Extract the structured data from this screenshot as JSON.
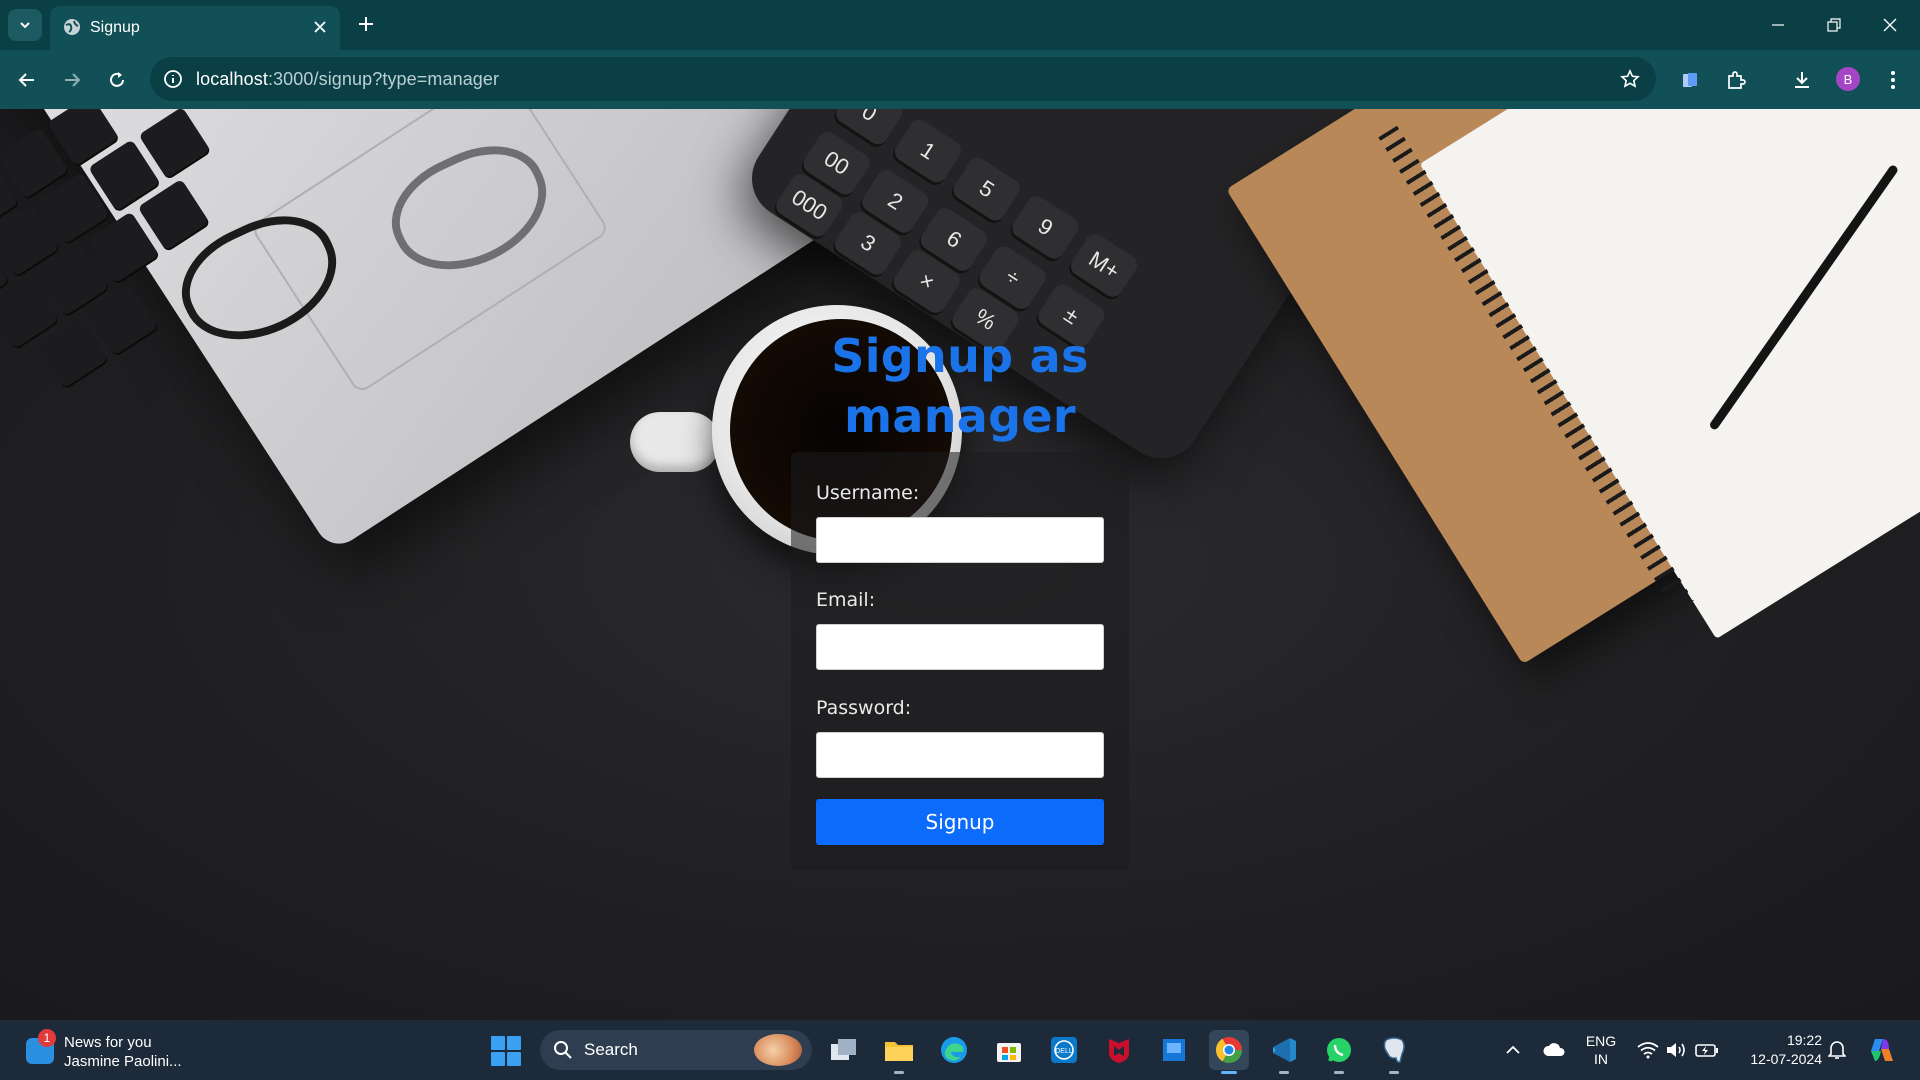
{
  "browser": {
    "tab_title": "Signup",
    "url_host": "localhost",
    "url_rest": ":3000/signup?type=manager",
    "profile_initial": "B",
    "colors": {
      "tabbar": "#0b3f46",
      "toolbar": "#125058"
    }
  },
  "page": {
    "title": "Signup as manager",
    "form": {
      "username_label": "Username:",
      "username_value": "",
      "email_label": "Email:",
      "email_value": "",
      "password_label": "Password:",
      "password_value": "",
      "submit_label": "Signup"
    },
    "colors": {
      "accent": "#1a73e8",
      "button": "#0b6bfa"
    }
  },
  "taskbar": {
    "news_title": "News for you",
    "news_subtitle": "Jasmine Paolini...",
    "news_badge": "1",
    "search_placeholder": "Search",
    "apps": [
      "task-view-icon",
      "file-explorer-icon",
      "edge-icon",
      "microsoft-store-icon",
      "dell-icon",
      "mcafee-icon",
      "app-icon",
      "chrome-icon",
      "vscode-icon",
      "whatsapp-icon",
      "postgresql-icon"
    ],
    "active_app": "chrome-icon",
    "language_top": "ENG",
    "language_bottom": "IN",
    "time": "19:22",
    "date": "12-07-2024"
  }
}
